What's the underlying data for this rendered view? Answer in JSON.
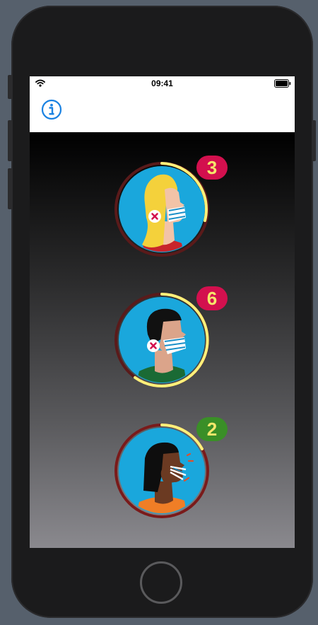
{
  "status_bar": {
    "time": "09:41",
    "wifi_icon": "wifi-icon",
    "battery_icon": "battery-icon"
  },
  "nav_bar": {
    "info_icon": "info-icon"
  },
  "colors": {
    "accent_blue": "#1a82e2",
    "badge_red": "#d3104e",
    "badge_green": "#3a8f27",
    "badge_text": "#f5e76b",
    "ring_yellow": "#fff07a",
    "avatar_bg": "#1aa7dc"
  },
  "people": [
    {
      "count": "3",
      "badge_color": "#d3104e",
      "hair": "blonde",
      "shirt": "#c8242c",
      "skin": "#f2c3a7",
      "progress": 0.33,
      "mask_worn": true
    },
    {
      "count": "6",
      "badge_color": "#d3104e",
      "hair": "black",
      "shirt": "#1a6a35",
      "skin": "#dba48a",
      "progress": 0.72,
      "mask_worn": true
    },
    {
      "count": "2",
      "badge_color": "#3a8f27",
      "hair": "black-long",
      "shirt": "#f07e26",
      "skin": "#6b3a22",
      "progress": 0.18,
      "mask_worn": false
    }
  ]
}
